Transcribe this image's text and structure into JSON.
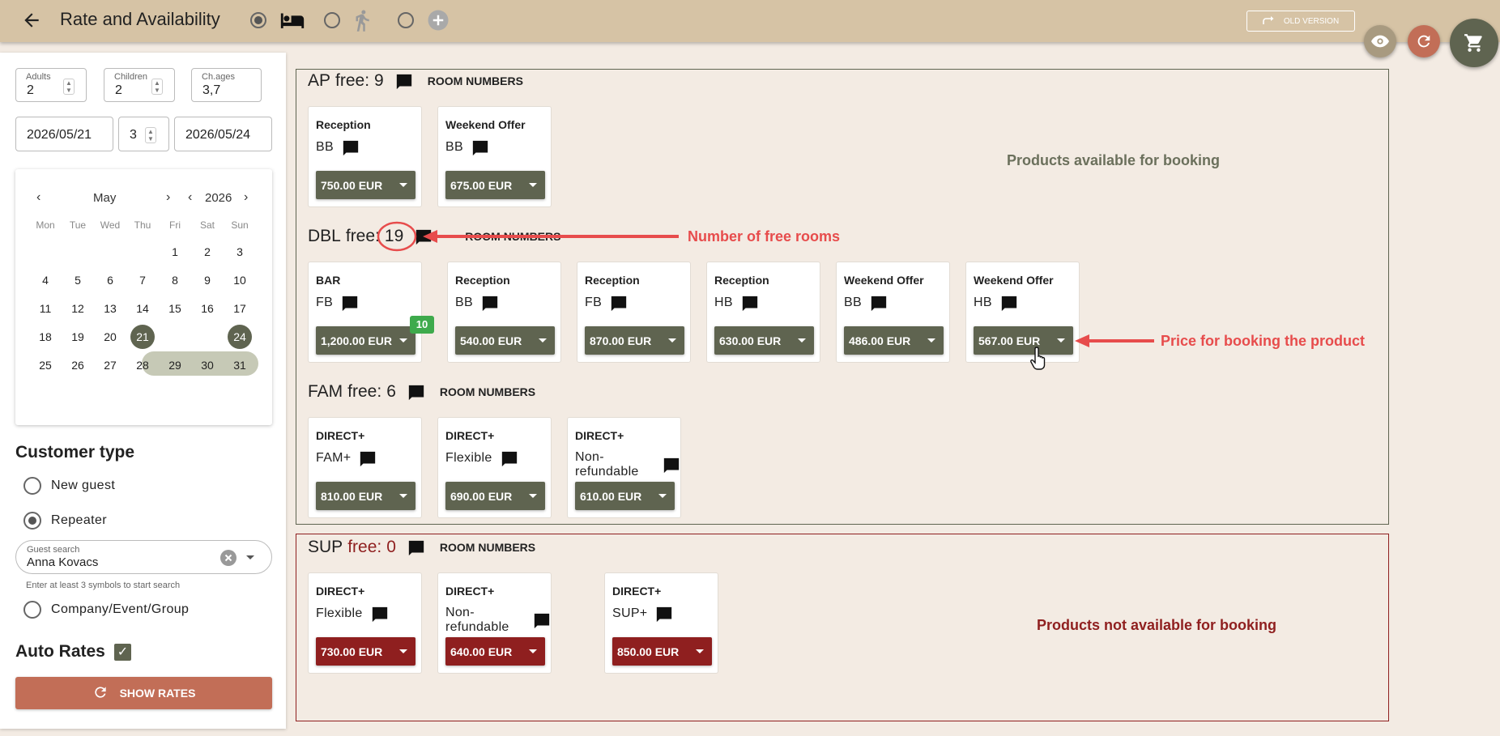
{
  "header": {
    "title": "Rate and Availability",
    "old_version_label": "OLD VERSION"
  },
  "search": {
    "adults_label": "Adults",
    "adults_value": "2",
    "children_label": "Children",
    "children_value": "2",
    "ch_ages_label": "Ch.ages",
    "ch_ages_value": "3,7",
    "date_from": "2026/05/21",
    "nights": "3",
    "date_to": "2026/05/24"
  },
  "calendar": {
    "month": "May",
    "year": "2026",
    "weekdays": [
      "Mon",
      "Tue",
      "Wed",
      "Thu",
      "Fri",
      "Sat",
      "Sun"
    ],
    "selected_start": 21,
    "selected_end": 24
  },
  "customer": {
    "title": "Customer type",
    "options": [
      "New guest",
      "Repeater",
      "Company/Event/Group"
    ],
    "selected": "Repeater",
    "guest_search_label": "Guest search",
    "guest_search_value": "Anna Kovacs",
    "guest_search_hint": "Enter at least 3 symbols to start search",
    "auto_rates_label": "Auto Rates",
    "show_rates_label": "SHOW RATES"
  },
  "rooms": [
    {
      "type": "AP",
      "free_label": "free:",
      "free": "9",
      "room_numbers_label": "ROOM NUMBERS",
      "products": [
        {
          "name": "Reception",
          "board": "BB",
          "price": "750.00 EUR"
        },
        {
          "name": "Weekend Offer",
          "board": "BB",
          "price": "675.00 EUR"
        }
      ]
    },
    {
      "type": "DBL",
      "free_label": "free:",
      "free": "19",
      "room_numbers_label": "ROOM NUMBERS",
      "products": [
        {
          "name": "BAR",
          "board": "FB",
          "price": "1,200.00 EUR",
          "badge": "10"
        },
        {
          "name": "Reception",
          "board": "BB",
          "price": "540.00 EUR"
        },
        {
          "name": "Reception",
          "board": "FB",
          "price": "870.00 EUR"
        },
        {
          "name": "Reception",
          "board": "HB",
          "price": "630.00 EUR"
        },
        {
          "name": "Weekend Offer",
          "board": "BB",
          "price": "486.00 EUR"
        },
        {
          "name": "Weekend Offer",
          "board": "HB",
          "price": "567.00 EUR"
        }
      ]
    },
    {
      "type": "FAM",
      "free_label": "free:",
      "free": "6",
      "room_numbers_label": "ROOM NUMBERS",
      "products": [
        {
          "name": "DIRECT+",
          "board": "FAM+",
          "price": "810.00 EUR"
        },
        {
          "name": "DIRECT+",
          "board": "Flexible",
          "price": "690.00 EUR"
        },
        {
          "name": "DIRECT+",
          "board": "Non-refundable",
          "price": "610.00 EUR"
        }
      ]
    },
    {
      "type": "SUP",
      "free_label": "free:",
      "free": "0",
      "room_numbers_label": "ROOM NUMBERS",
      "products": [
        {
          "name": "DIRECT+",
          "board": "Flexible",
          "price": "730.00 EUR"
        },
        {
          "name": "DIRECT+",
          "board": "Non-refundable",
          "price": "640.00 EUR"
        },
        {
          "name": "DIRECT+",
          "board": "SUP+",
          "price": "850.00 EUR"
        }
      ]
    }
  ],
  "annotations": {
    "available": "Products available for booking",
    "free_rooms": "Number of free rooms",
    "price": "Price for booking the product",
    "not_available": "Products not available for booking"
  },
  "colors": {
    "header_bg": "#d6c3a5",
    "accent_green": "#5f6450",
    "unavailable_red": "#8f1f1f",
    "annotation_red": "#e74c4c",
    "show_rates_bg": "#c26e57",
    "badge_green": "#3eaa4c"
  },
  "icons": {
    "back": "arrow-left-icon",
    "bed": "bed-icon",
    "walk": "walking-icon",
    "add": "plus-circle-icon",
    "old_version": "redo-arrow-icon",
    "eye": "eye-icon",
    "refresh": "refresh-icon",
    "cart": "cart-icon",
    "comment": "comment-icon"
  }
}
